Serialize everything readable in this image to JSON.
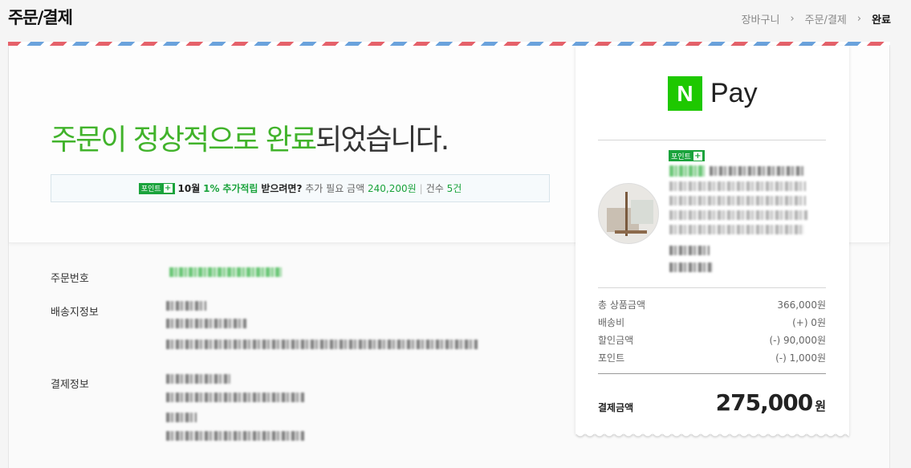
{
  "header": {
    "title": "주문/결제",
    "breadcrumb": [
      "장바구니",
      "주문/결제",
      "완료"
    ]
  },
  "main": {
    "headline_green": "주문이 정상적으로 완료",
    "headline_rest": "되었습니다.",
    "notice": {
      "badge": "포인트",
      "month": "10월",
      "rate": "1%",
      "action": "추가적립",
      "suffix": "받으려면?",
      "needed_label": "추가 필요 금액",
      "needed_value": "240,200원",
      "count_label": "건수",
      "count_value": "5건"
    },
    "info": {
      "order_number_label": "주문번호",
      "shipping_label": "배송지정보",
      "payment_label": "결제정보"
    }
  },
  "receipt": {
    "brand": "Pay",
    "brand_mark": "N",
    "point_badge": "포인트",
    "summary": [
      {
        "label": "총 상품금액",
        "value": "366,000원"
      },
      {
        "label": "배송비",
        "value": "(+) 0원"
      },
      {
        "label": "할인금액",
        "value": "(-) 90,000원"
      },
      {
        "label": "포인트",
        "value": "(-) 1,000원"
      }
    ],
    "total_label": "결제금액",
    "total_value": "275,000",
    "total_unit": "원"
  },
  "colors": {
    "accent_green": "#41b32b",
    "naver_green": "#1ec800",
    "stripe_red": "#e5616a",
    "stripe_blue": "#6aa2dc"
  }
}
